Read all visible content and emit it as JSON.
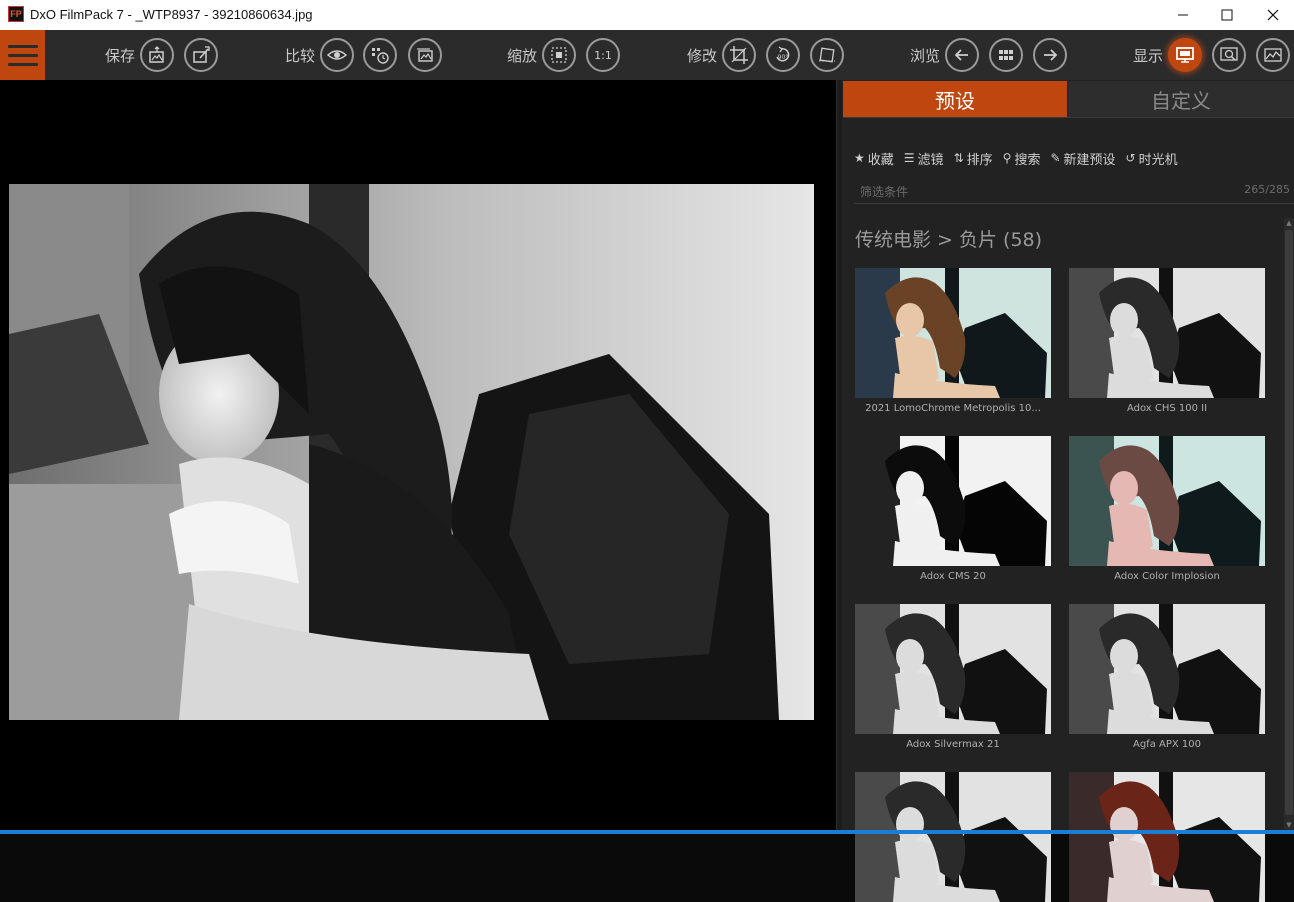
{
  "window": {
    "app_icon_text": "FP",
    "title": "DxO FilmPack 7 - _WTP8937 - 39210860634.jpg",
    "minimize": "—",
    "maximize": "☐",
    "close": "✕"
  },
  "toolbar": {
    "groups": {
      "save": "保存",
      "compare": "比较",
      "zoom": "缩放",
      "edit": "修改",
      "browse": "浏览",
      "display": "显示"
    },
    "zoom_1to1": "1:1",
    "rotate_label": "90°"
  },
  "panel": {
    "tabs": [
      "预设",
      "自定义"
    ],
    "actions": [
      {
        "icon": "star-icon",
        "glyph": "★",
        "label": "收藏"
      },
      {
        "icon": "list-icon",
        "glyph": "☰",
        "label": "滤镜"
      },
      {
        "icon": "sort-icon",
        "glyph": "⇅",
        "label": "排序"
      },
      {
        "icon": "search-icon",
        "glyph": "⚲",
        "label": "搜索"
      },
      {
        "icon": "new-preset-icon",
        "glyph": "✎",
        "label": "新建预设"
      },
      {
        "icon": "time-machine-icon",
        "glyph": "↺",
        "label": "时光机"
      }
    ],
    "filter_placeholder": "筛选条件",
    "filter_count": "265/285",
    "category": "传统电影 > 负片 (58)",
    "presets": [
      {
        "label": "2021 LomoChrome Metropolis 10...",
        "tone": "color"
      },
      {
        "label": "Adox CHS 100 II",
        "tone": "bw"
      },
      {
        "label": "Adox CMS 20",
        "tone": "bw-contrast"
      },
      {
        "label": "Adox Color Implosion",
        "tone": "pink"
      },
      {
        "label": "Adox Silvermax 21",
        "tone": "bw"
      },
      {
        "label": "Agfa APX 100",
        "tone": "bw"
      },
      {
        "label": "",
        "tone": "bw"
      },
      {
        "label": "",
        "tone": "red"
      }
    ]
  },
  "colors": {
    "accent": "#c0460f",
    "toolbar_bg": "#2b2b2b",
    "panel_bg": "#222222"
  }
}
